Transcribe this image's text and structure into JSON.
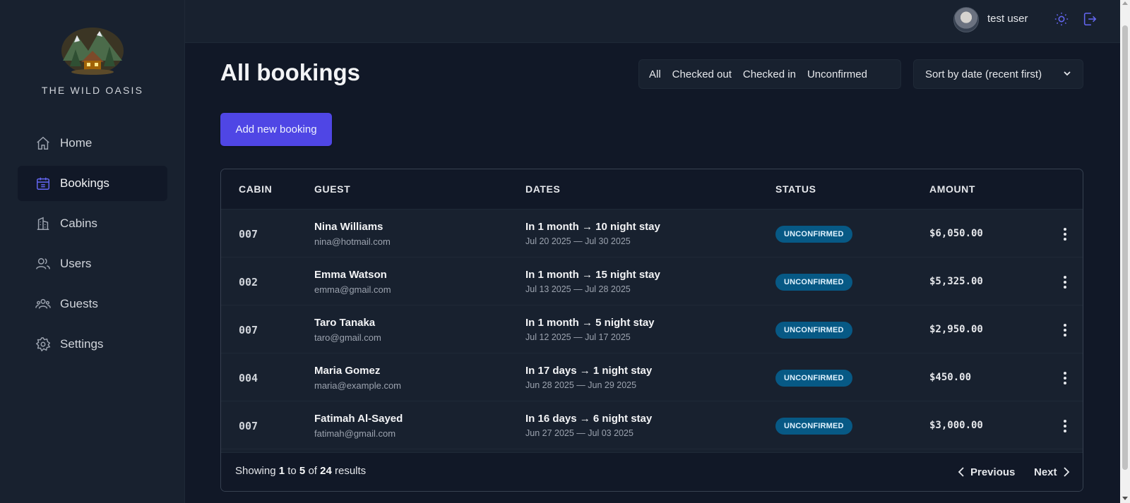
{
  "sidebar": {
    "brand": "THE WILD OASIS",
    "items": [
      {
        "label": "Home",
        "icon": "home-icon"
      },
      {
        "label": "Bookings",
        "icon": "calendar-icon",
        "active": true
      },
      {
        "label": "Cabins",
        "icon": "building-icon"
      },
      {
        "label": "Users",
        "icon": "users-icon"
      },
      {
        "label": "Guests",
        "icon": "user-group-icon"
      },
      {
        "label": "Settings",
        "icon": "gear-icon"
      }
    ]
  },
  "header": {
    "username": "test user"
  },
  "page": {
    "title": "All bookings",
    "filters": [
      "All",
      "Checked out",
      "Checked in",
      "Unconfirmed"
    ],
    "sort_label": "Sort by date (recent first)",
    "add_button": "Add new booking"
  },
  "table": {
    "headers": [
      "CABIN",
      "GUEST",
      "DATES",
      "STATUS",
      "AMOUNT"
    ],
    "rows": [
      {
        "cabin": "007",
        "guest": "Nina Williams",
        "email": "nina@hotmail.com",
        "stay": "In 1 month → 10 night stay",
        "range": "Jul 20 2025 — Jul 30 2025",
        "status": "UNCONFIRMED",
        "amount": "$6,050.00"
      },
      {
        "cabin": "002",
        "guest": "Emma Watson",
        "email": "emma@gmail.com",
        "stay": "In 1 month → 15 night stay",
        "range": "Jul 13 2025 — Jul 28 2025",
        "status": "UNCONFIRMED",
        "amount": "$5,325.00"
      },
      {
        "cabin": "007",
        "guest": "Taro Tanaka",
        "email": "taro@gmail.com",
        "stay": "In 1 month → 5 night stay",
        "range": "Jul 12 2025 — Jul 17 2025",
        "status": "UNCONFIRMED",
        "amount": "$2,950.00"
      },
      {
        "cabin": "004",
        "guest": "Maria Gomez",
        "email": "maria@example.com",
        "stay": "In 17 days → 1 night stay",
        "range": "Jun 28 2025 — Jun 29 2025",
        "status": "UNCONFIRMED",
        "amount": "$450.00"
      },
      {
        "cabin": "007",
        "guest": "Fatimah Al-Sayed",
        "email": "fatimah@gmail.com",
        "stay": "In 16 days → 6 night stay",
        "range": "Jun 27 2025 — Jul 03 2025",
        "status": "UNCONFIRMED",
        "amount": "$3,000.00"
      }
    ],
    "footer": {
      "showing_prefix": "Showing",
      "from": "1",
      "to_word": "to",
      "to": "5",
      "of_word": "of",
      "total": "24",
      "suffix": "results",
      "prev_label": "Previous",
      "next_label": "Next"
    }
  },
  "colors": {
    "accent": "#4f46e5",
    "badge_bg": "#075985",
    "background": "#111827",
    "panel": "#18212f"
  }
}
